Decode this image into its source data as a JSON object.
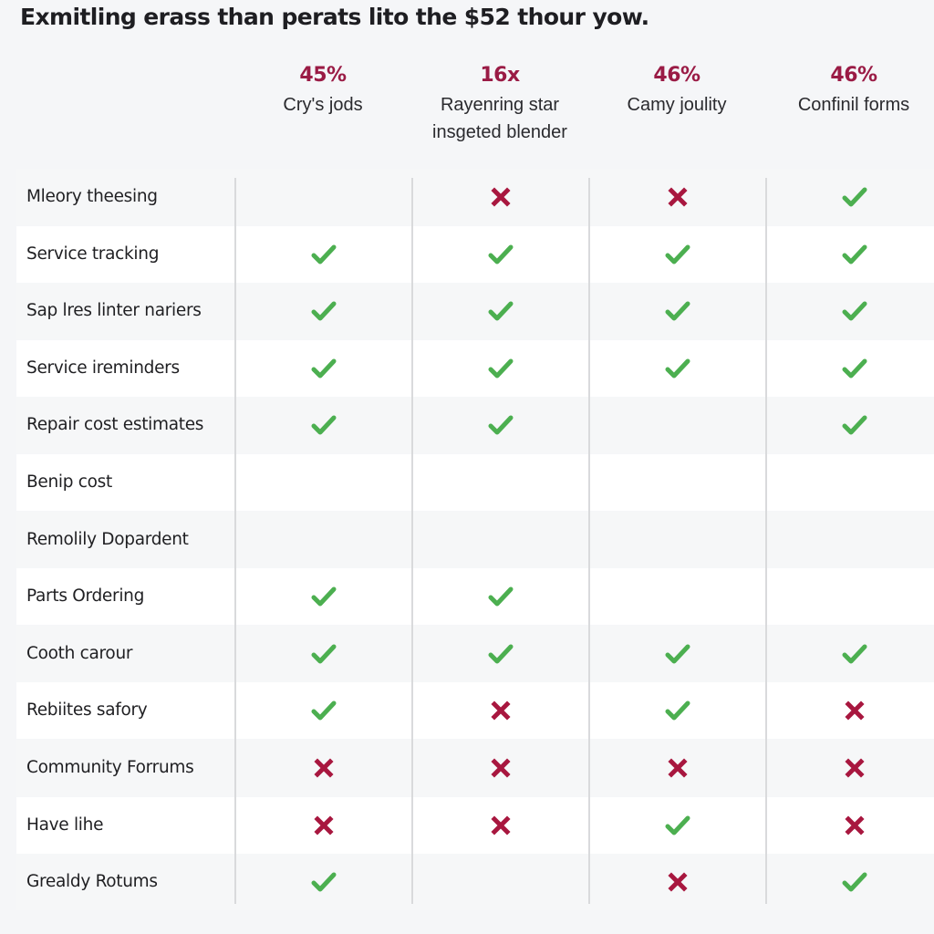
{
  "title": "Exmitling erass than perats lito the $52 thour yow.",
  "colors": {
    "accent": "#9a1b45",
    "check": "#4caf50",
    "cross": "#a8173f"
  },
  "columns": [
    {
      "stat": "45%",
      "label_lines": [
        "Cry's jods"
      ]
    },
    {
      "stat": "16x",
      "label_lines": [
        "Rayenring star",
        "insgeted blender"
      ]
    },
    {
      "stat": "46%",
      "label_lines": [
        "Camy joulity"
      ]
    },
    {
      "stat": "46%",
      "label_lines": [
        "Confinil forms"
      ]
    }
  ],
  "rows": [
    {
      "feature": "Mleory theesing",
      "values": [
        "none",
        "cross",
        "cross",
        "check"
      ]
    },
    {
      "feature": "Service tracking",
      "values": [
        "check",
        "check",
        "check",
        "check"
      ]
    },
    {
      "feature": "Sap lres linter nariers",
      "values": [
        "check",
        "check",
        "check",
        "check"
      ]
    },
    {
      "feature": "Service ireminders",
      "values": [
        "check",
        "check",
        "check",
        "check"
      ]
    },
    {
      "feature": "Repair cost estimates",
      "values": [
        "check",
        "check",
        "none",
        "check"
      ]
    },
    {
      "feature": "Benip cost",
      "values": [
        "none",
        "none",
        "none",
        "none"
      ]
    },
    {
      "feature": "Remolily Dopardent",
      "values": [
        "none",
        "none",
        "none",
        "none"
      ]
    },
    {
      "feature": "Parts Ordering",
      "values": [
        "check",
        "check",
        "none",
        "none"
      ]
    },
    {
      "feature": "Cooth carour",
      "values": [
        "check",
        "check",
        "check",
        "check"
      ]
    },
    {
      "feature": "Rebiites safory",
      "values": [
        "check",
        "cross",
        "check",
        "cross"
      ]
    },
    {
      "feature": "Community Forrums",
      "values": [
        "cross",
        "cross",
        "cross",
        "cross"
      ]
    },
    {
      "feature": "Have lihe",
      "values": [
        "cross",
        "cross",
        "check",
        "cross"
      ]
    },
    {
      "feature": "Grealdy Rotums",
      "values": [
        "check",
        "none",
        "cross",
        "check"
      ]
    }
  ]
}
